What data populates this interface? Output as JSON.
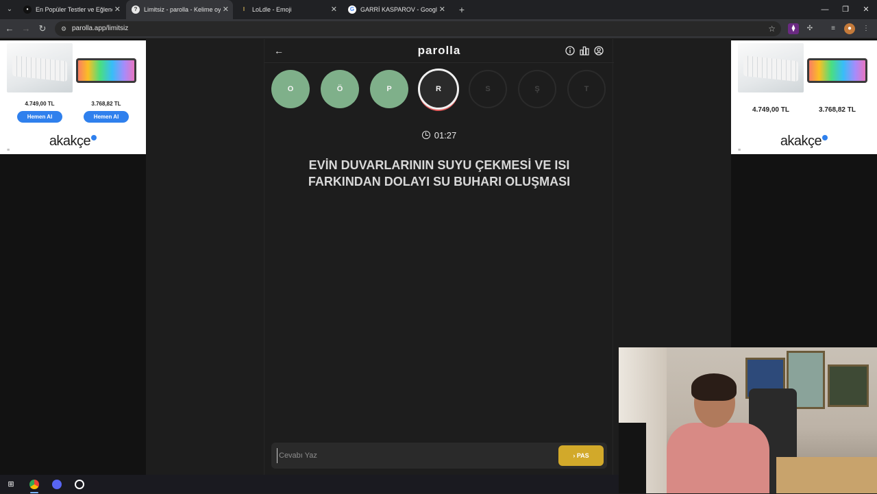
{
  "browser": {
    "tabs": [
      {
        "title": "En Popüler Testler ve Eğlenceli",
        "active": false,
        "favicon": "dark-favicon"
      },
      {
        "title": "Limitsiz - parolla - Kelime oyunu",
        "active": true,
        "favicon": "parolla-favicon"
      },
      {
        "title": "LoLdle - Emoji",
        "active": false,
        "favicon": "loldle-favicon"
      },
      {
        "title": "GARRİ KASPAROV - Google'da Ara",
        "active": false,
        "favicon": "google-favicon"
      }
    ],
    "url": "parolla.app/limitsiz"
  },
  "ads": {
    "left": {
      "products": [
        {
          "price": "4.749,00 TL",
          "button": "Hemen Al",
          "image": "white-keyboard"
        },
        {
          "price": "3.768,82 TL",
          "button": "Hemen Al",
          "image": "rgb-keyboard"
        }
      ],
      "logo": "akakçe"
    },
    "right": {
      "products": [
        {
          "price": "4.749,00 TL",
          "image": "white-keyboard"
        },
        {
          "price": "3.768,82 TL",
          "image": "rgb-keyboard"
        }
      ],
      "logo": "akakçe"
    }
  },
  "game": {
    "title": "parolla",
    "letters": [
      {
        "letter": "O",
        "state": "done"
      },
      {
        "letter": "Ö",
        "state": "done"
      },
      {
        "letter": "P",
        "state": "done"
      },
      {
        "letter": "R",
        "state": "current"
      },
      {
        "letter": "S",
        "state": "todo"
      },
      {
        "letter": "Ş",
        "state": "todo"
      },
      {
        "letter": "T",
        "state": "todo"
      }
    ],
    "timer": "01:27",
    "question": "EVİN DUVARLARININ SUYU ÇEKMESİ VE ISI FARKINDAN DOLAYI SU BUHARI OLUŞMASI",
    "answer": {
      "placeholder": "Cevabı Yaz",
      "value": ""
    },
    "pass_button": "PAS",
    "colors": {
      "done": "#7fb08a",
      "pass": "#d2a92a",
      "current_ring": "#e25b5b"
    }
  }
}
